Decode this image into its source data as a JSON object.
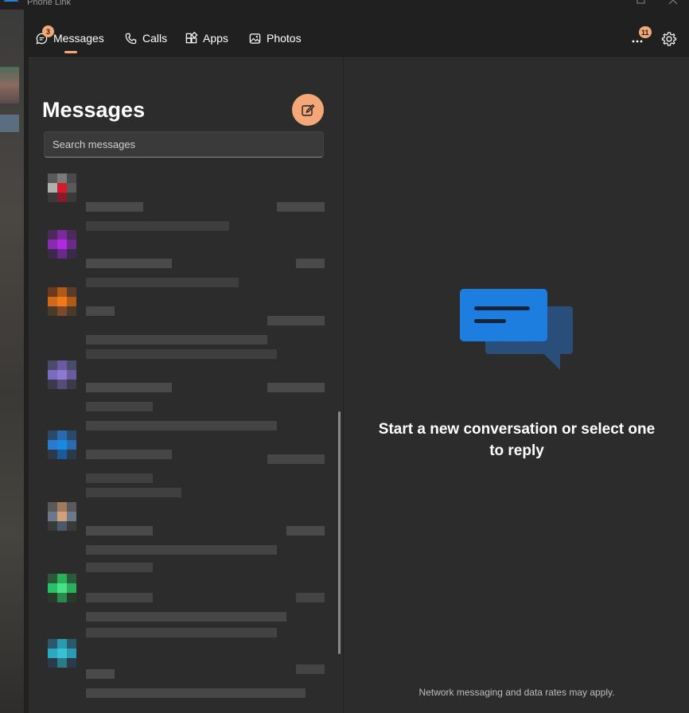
{
  "window": {
    "title": "Phone Link"
  },
  "nav": {
    "items": [
      {
        "label": "Messages",
        "icon": "chat-bubble-icon",
        "badge": "3",
        "active": true
      },
      {
        "label": "Calls",
        "icon": "phone-icon"
      },
      {
        "label": "Apps",
        "icon": "apps-grid-icon"
      },
      {
        "label": "Photos",
        "icon": "photo-icon"
      }
    ],
    "more_badge": "11",
    "accent": "#f4a878"
  },
  "messages_panel": {
    "title": "Messages",
    "search_placeholder": "Search messages",
    "conversations": [
      {
        "avatar_colors": [
          "#5a5a5a",
          "#7a7a7a",
          "#4a4a4a",
          "#b0b0b0",
          "#d01c2c",
          "#5a5a5a",
          "#3a3a3a",
          "#8a1a2a",
          "#3a3a3a"
        ]
      },
      {
        "avatar_colors": [
          "#4a2a5a",
          "#7a2a9a",
          "#4a2a5a",
          "#8a2ab0",
          "#b02ae0",
          "#6a2a8a",
          "#3a2a4a",
          "#6a2a8a",
          "#3a2a4a"
        ]
      },
      {
        "avatar_colors": [
          "#6a3a1a",
          "#b05a1a",
          "#5a3a2a",
          "#d06a1a",
          "#f07a1a",
          "#b05a1a",
          "#4a3a2a",
          "#7a4a2a",
          "#4a3a2a"
        ]
      },
      {
        "avatar_colors": [
          "#4a4a6a",
          "#6a5aa0",
          "#4a4a6a",
          "#7a6ac0",
          "#8a7ad0",
          "#6a5aa0",
          "#3a3a4a",
          "#5a4a7a",
          "#3a3a4a"
        ]
      },
      {
        "avatar_colors": [
          "#2a4a6a",
          "#2a6ab0",
          "#2a4a6a",
          "#2a7ad0",
          "#1a8ae0",
          "#2a6ab0",
          "#2a3a4a",
          "#1a5a9a",
          "#2a3a4a"
        ]
      },
      {
        "avatar_colors": [
          "#5a5a5a",
          "#a07a5a",
          "#5a5a5a",
          "#6a7a8a",
          "#d0a07a",
          "#6a7a8a",
          "#3a3a3a",
          "#4a5a6a",
          "#3a3a3a"
        ]
      },
      {
        "avatar_colors": [
          "#2a5a3a",
          "#2ab05a",
          "#2a5a3a",
          "#2ac06a",
          "#4ae08a",
          "#2ab05a",
          "#2a3a2a",
          "#2a8a4a",
          "#2a3a2a"
        ]
      },
      {
        "avatar_colors": [
          "#2a5a6a",
          "#2a9ab0",
          "#2a5a6a",
          "#2aaac0",
          "#3ac0d0",
          "#2a9ab0",
          "#2a3a4a",
          "#2a7a8a",
          "#2a3a4a"
        ]
      }
    ]
  },
  "empty_state": {
    "message": "Start a new conversation or select one to reply",
    "footnote": "Network messaging and data rates may apply."
  }
}
